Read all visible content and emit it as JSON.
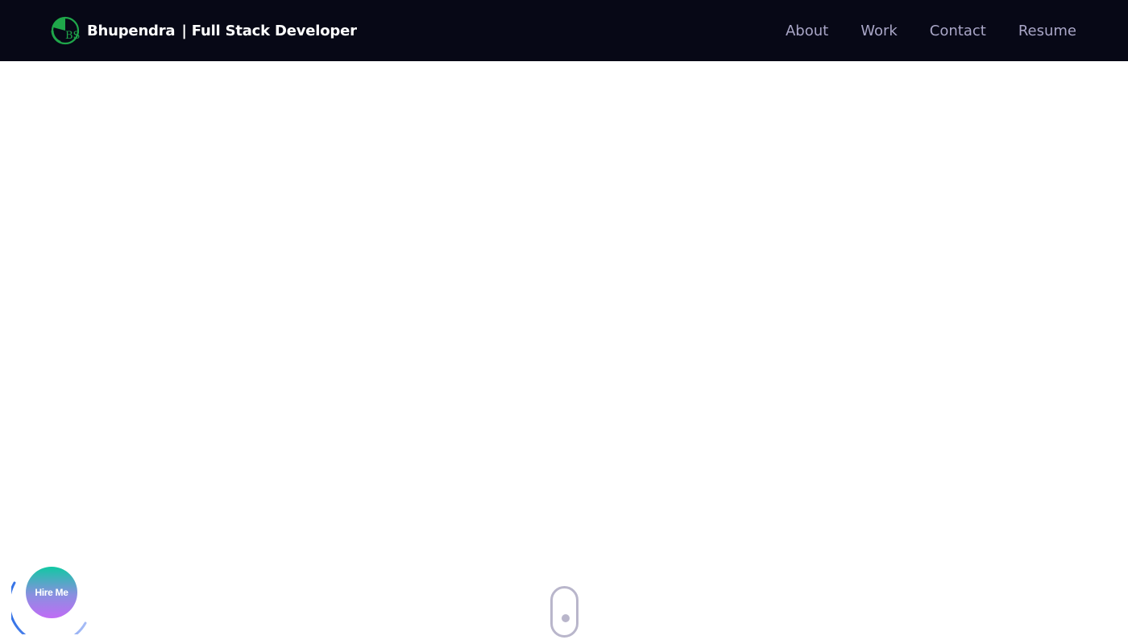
{
  "header": {
    "logo_icon": "bs-monogram-logo-icon",
    "brand_name": "Bhupendra",
    "brand_separator": "|",
    "brand_title": "Full Stack Developer",
    "nav": [
      {
        "label": "About"
      },
      {
        "label": "Work"
      },
      {
        "label": "Contact"
      },
      {
        "label": "Resume"
      }
    ],
    "colors": {
      "background": "#070816",
      "brand_text": "#ffffff",
      "nav_text": "#a9a6c7",
      "logo_green": "#1fa64a"
    }
  },
  "floating": {
    "hire_label": "Hire Me",
    "colors": {
      "gradient_top": "#11c8a3",
      "gradient_bottom": "#c06cf5",
      "ring": "#3b6fe0"
    }
  },
  "scroll_indicator": {
    "icon": "mouse-scroll-icon",
    "color": "#b9b6cb"
  }
}
